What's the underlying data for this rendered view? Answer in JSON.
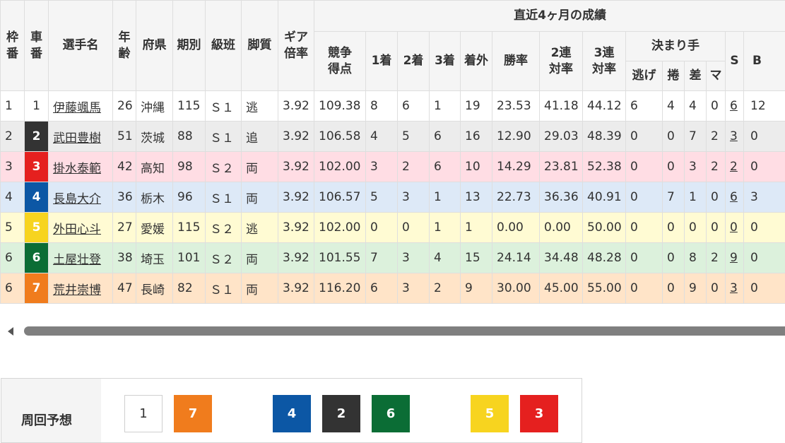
{
  "header": {
    "waku": [
      "枠",
      "番"
    ],
    "sha": [
      "車",
      "番"
    ],
    "name": "選手名",
    "age": [
      "年",
      "齢"
    ],
    "pref": "府県",
    "term": "期別",
    "class": "級班",
    "style": "脚質",
    "gear": [
      "ギア",
      "倍率"
    ],
    "recent": "直近4ヶ月の成績",
    "score": [
      "競争",
      "得点"
    ],
    "first": "1着",
    "second": "2着",
    "third": "3着",
    "out": "着外",
    "win": "勝率",
    "ren2": [
      "2連",
      "対率"
    ],
    "ren3": [
      "3連",
      "対率"
    ],
    "kimari": "決まり手",
    "nige": "逃げ",
    "makuri": "捲",
    "sashi": "差",
    "ma": "マ",
    "s": "S",
    "b": "B"
  },
  "car_colors": {
    "1": {
      "bg": "#ffffff",
      "fg": "#333333"
    },
    "2": {
      "bg": "#333333",
      "fg": "#ffffff"
    },
    "3": {
      "bg": "#e5201f",
      "fg": "#ffffff"
    },
    "4": {
      "bg": "#0c57a5",
      "fg": "#ffffff"
    },
    "5": {
      "bg": "#f7d41f",
      "fg": "#ffffff"
    },
    "6": {
      "bg": "#0b6d35",
      "fg": "#ffffff"
    },
    "7": {
      "bg": "#f07c1d",
      "fg": "#ffffff"
    }
  },
  "riders": [
    {
      "waku": "1",
      "car": "1",
      "name": "伊藤颯馬",
      "age": "26",
      "pref": "沖縄",
      "term": "115",
      "class": "Ｓ１",
      "style": "逃",
      "gear": "3.92",
      "score": "109.38",
      "first": "8",
      "second": "6",
      "third": "1",
      "out": "19",
      "win": "23.53",
      "ren2": "41.18",
      "ren3": "44.12",
      "nige": "6",
      "makuri": "4",
      "sashi": "4",
      "ma": "0",
      "s": "6",
      "b": "12"
    },
    {
      "waku": "2",
      "car": "2",
      "name": "武田豊樹",
      "age": "51",
      "pref": "茨城",
      "term": "88",
      "class": "Ｓ１",
      "style": "追",
      "gear": "3.92",
      "score": "106.58",
      "first": "4",
      "second": "5",
      "third": "6",
      "out": "16",
      "win": "12.90",
      "ren2": "29.03",
      "ren3": "48.39",
      "nige": "0",
      "makuri": "0",
      "sashi": "7",
      "ma": "2",
      "s": "3",
      "b": "0"
    },
    {
      "waku": "3",
      "car": "3",
      "name": "掛水泰範",
      "age": "42",
      "pref": "高知",
      "term": "98",
      "class": "Ｓ２",
      "style": "両",
      "gear": "3.92",
      "score": "102.00",
      "first": "3",
      "second": "2",
      "third": "6",
      "out": "10",
      "win": "14.29",
      "ren2": "23.81",
      "ren3": "52.38",
      "nige": "0",
      "makuri": "0",
      "sashi": "3",
      "ma": "2",
      "s": "2",
      "b": "0"
    },
    {
      "waku": "4",
      "car": "4",
      "name": "長島大介",
      "age": "36",
      "pref": "栃木",
      "term": "96",
      "class": "Ｓ１",
      "style": "両",
      "gear": "3.92",
      "score": "106.57",
      "first": "5",
      "second": "3",
      "third": "1",
      "out": "13",
      "win": "22.73",
      "ren2": "36.36",
      "ren3": "40.91",
      "nige": "0",
      "makuri": "7",
      "sashi": "1",
      "ma": "0",
      "s": "6",
      "b": "3"
    },
    {
      "waku": "5",
      "car": "5",
      "name": "外田心斗",
      "age": "27",
      "pref": "愛媛",
      "term": "115",
      "class": "Ｓ２",
      "style": "逃",
      "gear": "3.92",
      "score": "102.00",
      "first": "0",
      "second": "0",
      "third": "1",
      "out": "1",
      "win": "0.00",
      "ren2": "0.00",
      "ren3": "50.00",
      "nige": "0",
      "makuri": "0",
      "sashi": "0",
      "ma": "0",
      "s": "0",
      "b": "0"
    },
    {
      "waku": "6",
      "car": "6",
      "name": "土屋壮登",
      "age": "38",
      "pref": "埼玉",
      "term": "101",
      "class": "Ｓ２",
      "style": "両",
      "gear": "3.92",
      "score": "101.55",
      "first": "7",
      "second": "3",
      "third": "4",
      "out": "15",
      "win": "24.14",
      "ren2": "34.48",
      "ren3": "48.28",
      "nige": "0",
      "makuri": "0",
      "sashi": "8",
      "ma": "2",
      "s": "9",
      "b": "0"
    },
    {
      "waku": "6",
      "car": "7",
      "name": "荒井崇博",
      "age": "47",
      "pref": "長崎",
      "term": "82",
      "class": "Ｓ１",
      "style": "両",
      "gear": "3.92",
      "score": "116.20",
      "first": "6",
      "second": "3",
      "third": "2",
      "out": "9",
      "win": "30.00",
      "ren2": "45.00",
      "ren3": "55.00",
      "nige": "0",
      "makuri": "0",
      "sashi": "9",
      "ma": "0",
      "s": "3",
      "b": "0"
    }
  ],
  "forecast": {
    "label": "周回予想",
    "chips": [
      "1",
      "7",
      "4",
      "2",
      "6",
      "5",
      "3"
    ]
  }
}
